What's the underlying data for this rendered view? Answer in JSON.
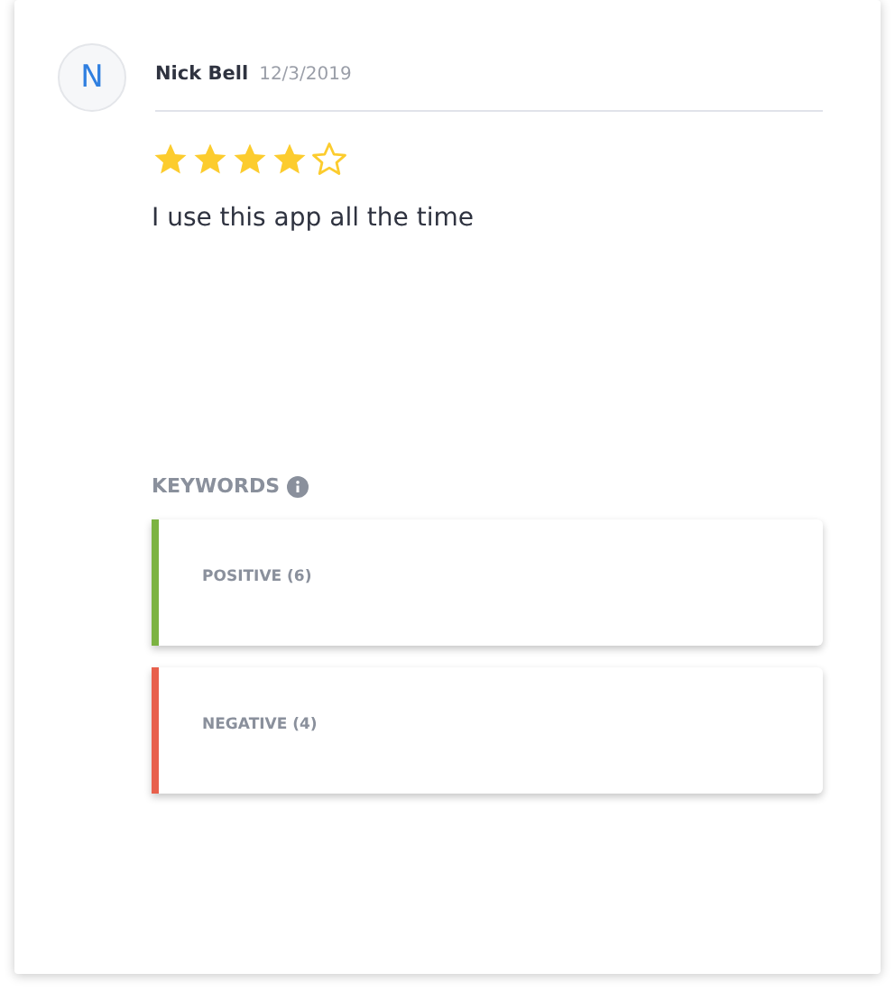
{
  "review": {
    "avatar_letter": "N",
    "author": "Nick Bell",
    "date": "12/3/2019",
    "stars": 4,
    "text": "I use this app all the time"
  },
  "keywords": {
    "title": "KEYWORDS",
    "groups": [
      {
        "label": "POSITIVE (6)",
        "color": "#7cb342"
      },
      {
        "label": "NEGATIVE (4)",
        "color": "#e8604c"
      }
    ]
  }
}
